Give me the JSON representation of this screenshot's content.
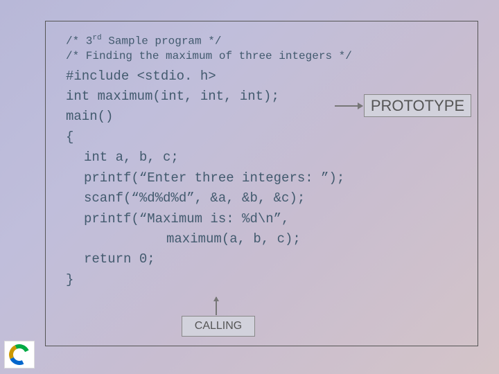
{
  "comments": {
    "line1_a": "/* 3",
    "line1_sup": "rd",
    "line1_b": " Sample program */",
    "line2": "/* Finding the maximum of three integers */"
  },
  "code": {
    "l1": "#include <stdio. h>",
    "l2": "int maximum(int, int, int);",
    "l3": "main()",
    "l4": "{",
    "l5": "int a, b, c;",
    "l6": "printf(“Enter three integers: ”);",
    "l7": "scanf(“%d%d%d”, &a, &b, &c);",
    "l8": "printf(“Maximum is: %d\\n”,",
    "l9": "maximum(a, b, c);",
    "l10": "return 0;",
    "l11": "}"
  },
  "labels": {
    "prototype": "PROTOTYPE",
    "calling": "CALLING"
  }
}
